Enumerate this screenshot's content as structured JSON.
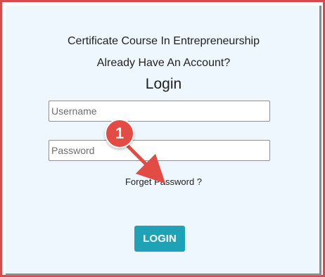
{
  "page": {
    "course_title": "Certificate Course In Entrepreneurship",
    "account_prompt": "Already Have An Account?",
    "login_heading": "Login"
  },
  "form": {
    "username_placeholder": "Username",
    "password_placeholder": "Password",
    "forgot_password_label": "Forget Password ?",
    "login_button_label": "LOGIN"
  },
  "annotation": {
    "badge_number": "1",
    "badge_color": "#e34b45",
    "arrow_color": "#e34b45"
  },
  "colors": {
    "panel_background": "#eef7fd",
    "button_background": "#1fa2b5",
    "frame_border": "#d94b4b"
  }
}
